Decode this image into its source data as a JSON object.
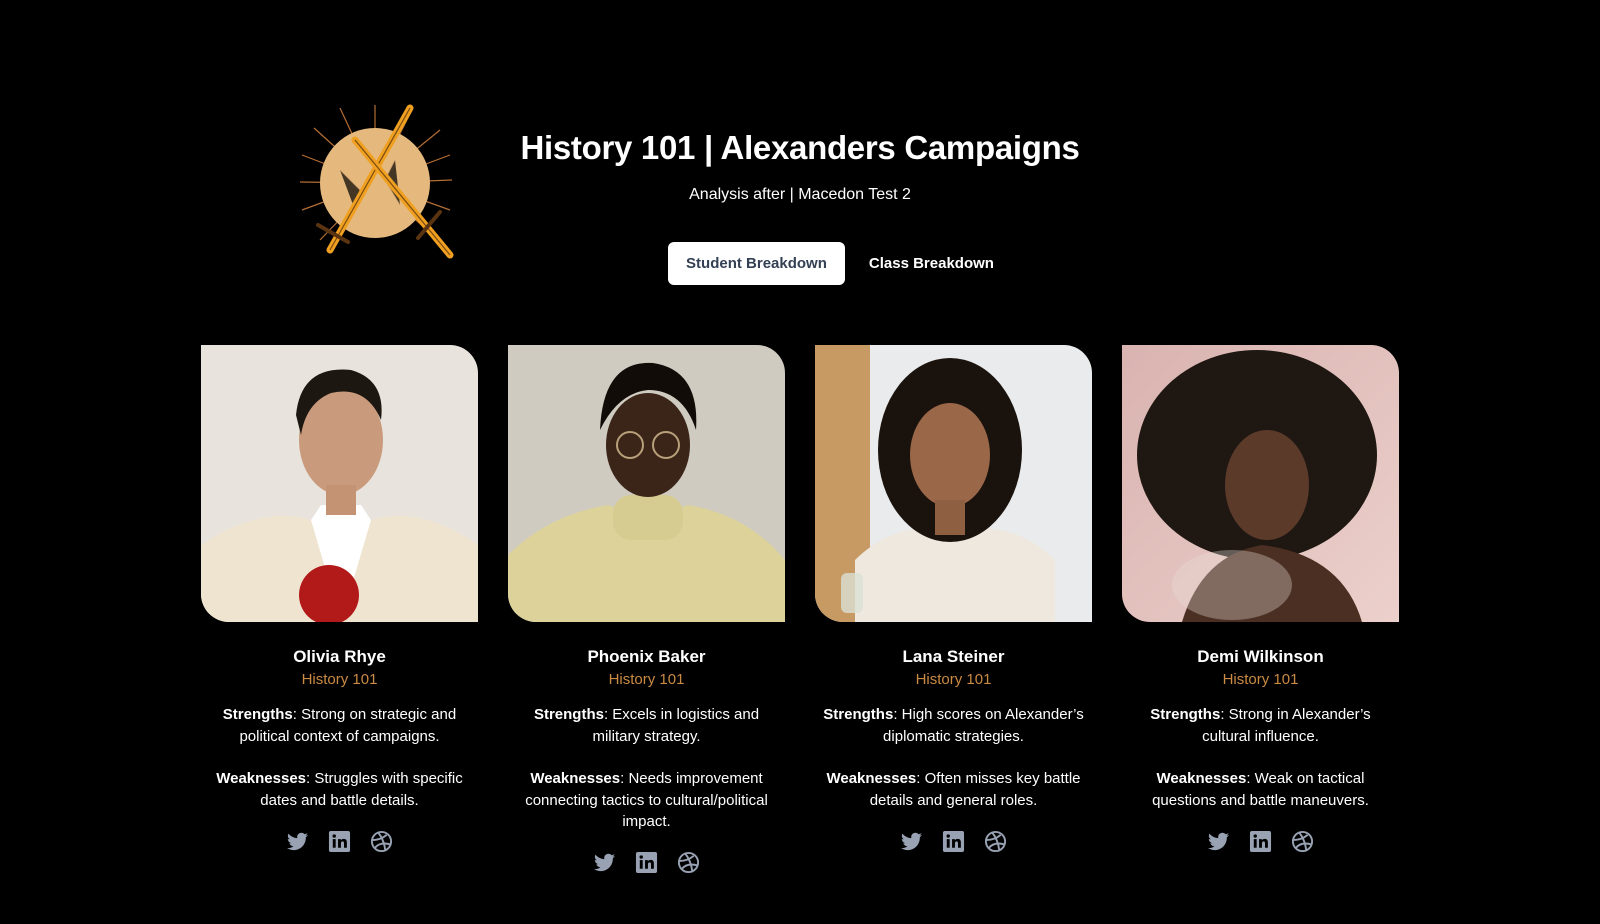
{
  "header": {
    "title": "History 101 | Alexanders Campaigns",
    "subtitle": "Analysis after | Macedon Test 2"
  },
  "tabs": [
    {
      "label": "Student Breakdown",
      "active": true
    },
    {
      "label": "Class Breakdown",
      "active": false
    }
  ],
  "colors": {
    "background": "#000000",
    "accent": "#c98a44",
    "icon": "#98a2b3",
    "active_tab_text": "#344054"
  },
  "students": [
    {
      "name": "Olivia Rhye",
      "course": "History 101",
      "strengths_label": "Strengths",
      "strengths": ": Strong on strategic and political context of campaigns.",
      "weaknesses_label": "Weaknesses",
      "weaknesses": ": Struggles with specific dates and battle details.",
      "photo_icon": "portrait-photo"
    },
    {
      "name": "Phoenix Baker",
      "course": "History 101",
      "strengths_label": "Strengths",
      "strengths": ": Excels in logistics and military strategy.",
      "weaknesses_label": "Weaknesses",
      "weaknesses": ": Needs improvement connecting tactics to cultural/political impact.",
      "photo_icon": "portrait-photo"
    },
    {
      "name": "Lana Steiner",
      "course": "History 101",
      "strengths_label": "Strengths",
      "strengths": ": High scores on Alexander’s diplomatic strategies.",
      "weaknesses_label": "Weaknesses",
      "weaknesses": ": Often misses key battle details and general roles.",
      "photo_icon": "portrait-photo"
    },
    {
      "name": "Demi Wilkinson",
      "course": "History 101",
      "strengths_label": "Strengths",
      "strengths": ": Strong in Alexander’s cultural influence.",
      "weaknesses_label": "Weaknesses",
      "weaknesses": ": Weak on tactical questions and battle maneuvers.",
      "photo_icon": "portrait-photo"
    }
  ],
  "social_icons": [
    "twitter-icon",
    "linkedin-icon",
    "dribbble-icon"
  ]
}
